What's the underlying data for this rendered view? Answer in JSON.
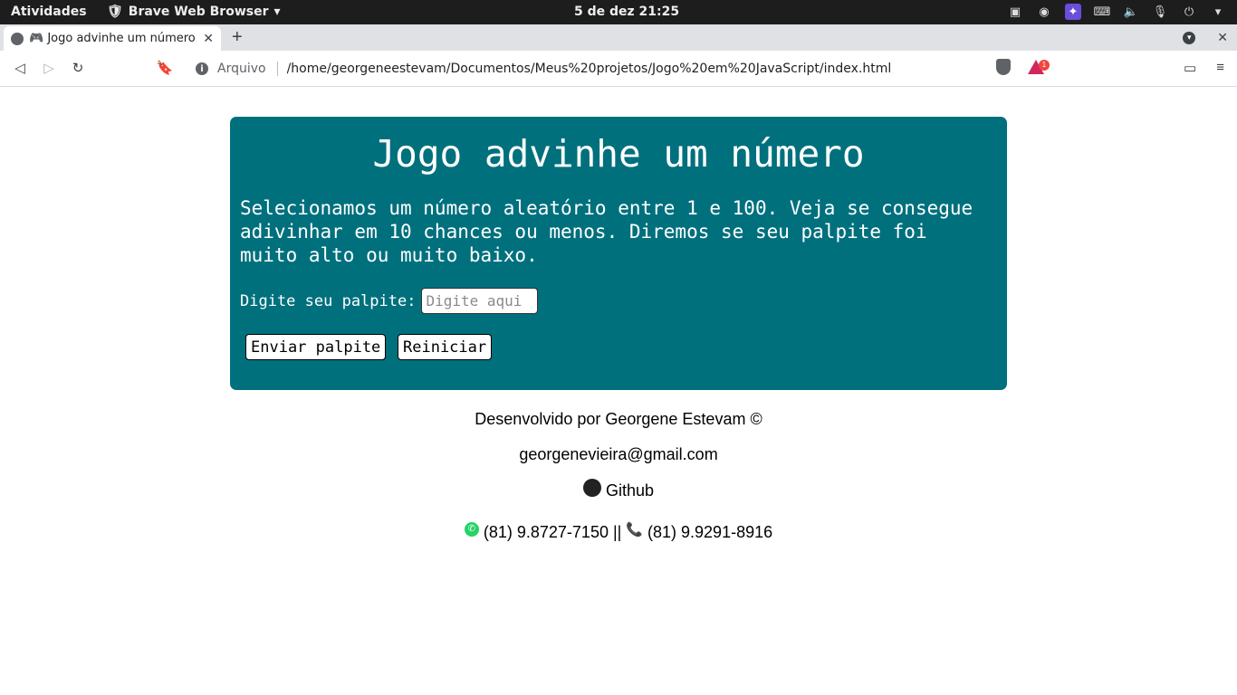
{
  "system_bar": {
    "activities": "Atividades",
    "app_name": "Brave Web Browser",
    "clock": "5 de dez  21:25"
  },
  "browser": {
    "tab_title": "🎮 Jogo advinhe um número",
    "close_glyph": "✕",
    "new_tab_glyph": "+",
    "security_label": "Arquivo",
    "url": "/home/georgeneestevam/Documentos/Meus%20projetos/Jogo%20em%20JavaScript/index.html",
    "rewards_badge": "1"
  },
  "game": {
    "title": "Jogo advinhe um número",
    "intro": "Selecionamos um número aleatório entre 1 e 100. Veja se consegue adivinhar em 10 chances ou menos. Diremos se seu palpite foi muito alto ou muito baixo.",
    "guess_label": "Digite seu palpite:",
    "guess_placeholder": "Digite aqui",
    "submit_label": "Enviar palpite",
    "reset_label": "Reiniciar"
  },
  "footer": {
    "credit": "Desenvolvido por Georgene Estevam ©",
    "email": "georgenevieira@gmail.com",
    "github": "Github",
    "whatsapp": "(81) 9.8727-7150",
    "separator": "||",
    "phone": "(81) 9.9291-8916"
  },
  "colors": {
    "game_panel": "#00707d",
    "topbar": "#1d1d1d"
  }
}
